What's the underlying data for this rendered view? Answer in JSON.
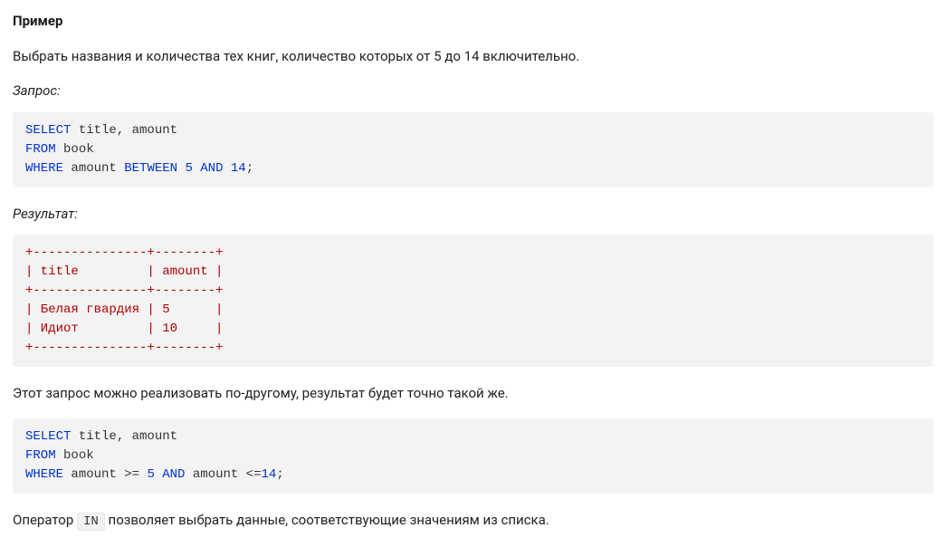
{
  "heading": "Пример",
  "intro": "Выбрать названия и количества тех книг, количество которых от 5 до 14 включительно.",
  "query_label": "Запрос:",
  "result_label": "Результат:",
  "code1": {
    "k_select": "SELECT",
    "cols": " title, amount",
    "k_from": "FROM",
    "table": " book",
    "k_where": "WHERE",
    "mid": " amount ",
    "k_between": "BETWEEN",
    "sp1": " ",
    "n5": "5",
    "sp2": " ",
    "k_and": "AND",
    "sp3": " ",
    "n14": "14",
    "semi": ";"
  },
  "result_table": "+---------------+--------+\n| title         | amount |\n+---------------+--------+\n| Белая гвардия | 5      |\n| Идиот         | 10     |\n+---------------+--------+",
  "between_text": "Этот запрос можно реализовать по-другому, результат будет точно такой же.",
  "code2": {
    "k_select": "SELECT",
    "cols": " title, amount",
    "k_from": "FROM",
    "table": " book",
    "k_where": "WHERE",
    "mid1": " amount >= ",
    "n5": "5",
    "sp1": " ",
    "k_and": "AND",
    "mid2": " amount <=",
    "n14": "14",
    "semi": ";"
  },
  "final_before": "Оператор ",
  "final_code": "IN",
  "final_after": " позволяет выбрать данные, соответствующие значениям из списка."
}
